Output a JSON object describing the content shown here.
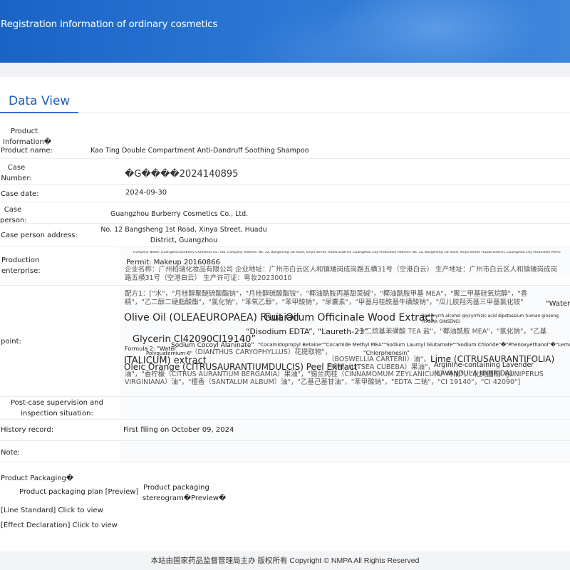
{
  "banner": {
    "title": "Registration information of ordinary cosmetics"
  },
  "tab": {
    "label": "Data View"
  },
  "product_info": {
    "section_label": "Product Information�",
    "product_name_label": "Product name:",
    "product_name": "Kao Ting Double Compartment Anti-Dandruff Soothing Shampoo",
    "case_number_label": "Case Number:",
    "case_number": "�G����2024140895",
    "case_date_label": "Case date:",
    "case_date": "2024-09-30",
    "case_person_label": "Case person:",
    "case_person": "Guangzhou Burberry Cosmetics Co., Ltd.",
    "case_person_address_label": "Case person address:",
    "case_person_address": "No. 12 Bangsheng 1st Road, Xinya Street, Huadu District, Guangzhou",
    "production_enterprise_label": "Production enterprise:",
    "production_enterprise_small": "Company Name: Guangzhou Burberry Cosmetics Co., Ltd. Company Address: No. 12, Bangsheng 1st Road, Xinya Street, Huadu District, Guangzhou City Production Address: No. 12, Bangsheng 1st Road, Xinya Street, Huadu District, Guangzhou City Production Permit",
    "production_permit": "Permit: Makeup 20160866",
    "production_enterprise_cn": "企业名称：广州柏瑞化妆品有限公司 企业地址：广州市白云区人和镇矮岗成岗路五横31号（空港白云） 生产地址：广州市白云区人和镇矮岗成岗路五横31号（空港白云） 生产许可证：粤妆20230010",
    "formula_label": "point:",
    "formula_cn_1": "配方1：[\"水\"，\"月桂醇聚醚硫酸酯钠\"，\"月桂醇硫酸酯铵\"，\"椰油酰胺丙基甜菜碱\"，\"椰油酰胺甲基 MEA\"，\"聚二甲基硅氧烷醇\"，\"香精\"，\"乙二醇二硬脂酸酯\"，\"氯化钠\"，\"苯氧乙醇\"，\"苯甲酸钠\"，\"尿囊素\"，\"甲基月桂酰基牛磺酸钠\"，\"瓜儿胶羟丙基三甲基氯化铵\"",
    "formula_en_water": "\"Water",
    "formula_en_olive": "Olive Oil (OLEAEUROPAEA) Fruit Oil",
    "formula_en_guaiacum": "Guaiacum Officinale Wood Extract",
    "formula_en_tiny1": "Red myrrh alcohol glycyrrhizic acid dipotassium human ginseng (PANAX GINSENG)",
    "formula_en_disodium": "“Disodium EDTA”, “Laureth-23”",
    "formula_cn_2": "十二烷基苯磺酸 TEA 盐\"，\"椰油酰胺 MEA\"，\"氯化钠\"，\"乙基",
    "formula_en_glycerin": "Glycerin CI42090CI19140”",
    "formula_2_label": "Formula 2: \"Water",
    "formula_en_sodium_cocoyl": "Sodium Cocoyl Alaninate\"",
    "formula_en_cocamidopropyl": "\"Cocamidopropyl Betaine\"\"Cocamide Methyl MEA\"\"Sodium Lauroyl Glutamate\"\"Sodium Chloride\"�\"Phenoxyethanol\"�\"Lemon\"",
    "formula_en_polyquat": "Polyquaternium-6\"",
    "formula_cn_3": "（DIANTHUS CARYOPHYLLUS）花提取物\"，",
    "formula_en_chlorphenesin": "\"Chlorphenesin\"",
    "formula_en_italicum": "ITALICUM) extract",
    "formula_en_boswellia": "（BOSWELLIA CARTERII）油\"，",
    "formula_en_lime": "Lime (CITRUSAURANTIFOLIA)",
    "formula_en_orange": "Oleic Orange (CITRUSAURANTIUMDULCIS) Peel Extract",
    "formula_cn_4": "\"鸡椒（LITSEA CUBEBA）果油\"，",
    "formula_en_arginine": "Arginine-containing Lavender (LAVANDULA HYBRIDA)",
    "formula_cn_5": "油\"，\"香柠檬（CITRUS AURANTIUM BERGAMIA）果油\"，\"锡兰肉桂（CINNAMOMUM ZEYLANICUM）叶油\"，\"北美圆柏（JUNIPERUS VIRGINIANA）油\"，\"檀香（SANTALUM ALBUM）油\"，\"乙基己基甘油\"，\"苯甲酸钠\"，\"EDTA 二钠\"，\"CI 19140\"，\"CI 42090\"]",
    "post_case_label": "Post-case supervision and inspection situation:",
    "history_label": "History record:",
    "history_value": "First filing on October 09, 2024",
    "note_label": "Note:"
  },
  "packaging": {
    "section_label": "Product Packaging�",
    "plan_label": "Product packaging plan [Preview]",
    "stereogram_label": "Product packaging stereogram�Preview�",
    "line_standard": "[Line Standard] Click to view",
    "effect_declaration": "[Effect Declaration] Click to view"
  },
  "footer": {
    "text": "本站由国家药品监督管理局主办 版权所有 Copyright © NMPA All Rights Reserved"
  }
}
